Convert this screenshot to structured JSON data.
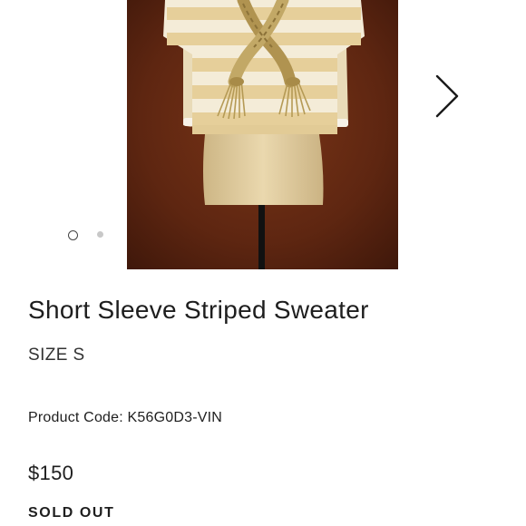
{
  "product": {
    "title": "Short Sleeve Striped Sweater",
    "size": "SIZE S",
    "code_label": "Product Code:",
    "code": "K56G0D3-VIN",
    "price": "$150",
    "stock_status": "SOLD OUT"
  },
  "carousel": {
    "slide_count": 2,
    "active_slide": 1,
    "next_icon": "chevron-right-icon"
  },
  "colors": {
    "background": "#ffffff",
    "text": "#1e1e1e",
    "image_backdrop": "#5a2410",
    "sweater_cream": "#f3ead4",
    "sweater_stripe": "#e6cf9a",
    "rope_gold": "#b59a55",
    "skirt": "#e2cfa4"
  }
}
